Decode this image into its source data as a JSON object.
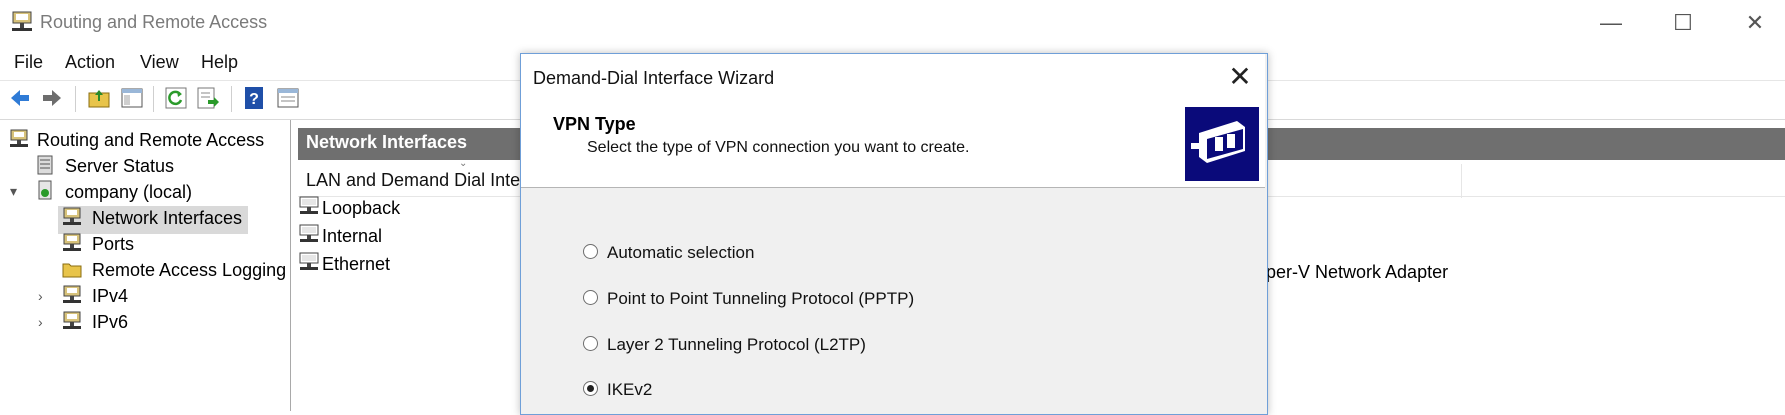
{
  "window": {
    "title": "Routing and Remote Access",
    "controls": {
      "minimize": "—",
      "maximize": "☐",
      "close": "✕"
    }
  },
  "menu": [
    "File",
    "Action",
    "View",
    "Help"
  ],
  "toolbar": {
    "icons": [
      "back-arrow-icon",
      "forward-arrow-icon",
      "up-folder-icon",
      "show-hide-tree-icon",
      "refresh-icon",
      "export-list-icon",
      "help-icon",
      "properties-icon"
    ]
  },
  "tree": {
    "root": "Routing and Remote Access",
    "items": [
      {
        "label": "Server Status",
        "icon": "server-status-icon"
      },
      {
        "label": "company (local)",
        "icon": "server-icon",
        "expanded": true
      },
      {
        "label": "Network Interfaces",
        "icon": "network-icon",
        "selected": true
      },
      {
        "label": "Ports",
        "icon": "network-icon"
      },
      {
        "label": "Remote Access Logging",
        "icon": "folder-icon"
      },
      {
        "label": "IPv4",
        "icon": "network-icon",
        "collapsed": true
      },
      {
        "label": "IPv6",
        "icon": "network-icon",
        "collapsed": true
      }
    ]
  },
  "right_pane": {
    "header": "Network Interfaces",
    "column_header": "LAN and Demand Dial Inter",
    "interfaces": [
      "Loopback",
      "Internal",
      "Ethernet"
    ],
    "adapter_partial": "per-V Network Adapter"
  },
  "dialog": {
    "title": "Demand-Dial Interface Wizard",
    "close": "✕",
    "heading": "VPN Type",
    "subheading": "Select the type of VPN connection you want to create.",
    "options": [
      {
        "label": "Automatic selection",
        "checked": false
      },
      {
        "label": "Point to Point Tunneling Protocol (PPTP)",
        "checked": false
      },
      {
        "label": "Layer 2 Tunneling Protocol (L2TP)",
        "checked": false
      },
      {
        "label": "IKEv2",
        "checked": true
      }
    ]
  },
  "colors": {
    "accent_header": "#6f6f6f",
    "banner_bg": "#0a0a7a",
    "selection": "#d9d9d9"
  }
}
